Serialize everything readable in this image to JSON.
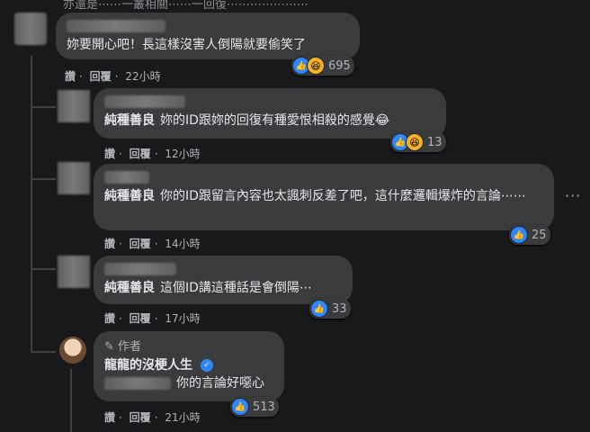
{
  "top_cut_text": "亦還是⋯⋯一叢相關⋯⋯一回復⋯⋯⋯⋯⋯⋯⋯",
  "comments": [
    {
      "text": "妳要開心吧！長這樣沒害人倒陽就要偷笑了",
      "meta": {
        "like": "讚",
        "reply": "回覆",
        "time": "22小時"
      },
      "reaction_count": "695"
    },
    {
      "tag": "純種善良",
      "text": "妳的ID跟妳的回復有種愛恨相殺的感覺😂",
      "meta": {
        "like": "讚",
        "reply": "回覆",
        "time": "12小時"
      },
      "reaction_count": "13"
    },
    {
      "tag": "純種善良",
      "text": "你的ID跟留言內容也太諷刺反差了吧，這什麼邏輯爆炸的言論⋯⋯",
      "meta": {
        "like": "讚",
        "reply": "回覆",
        "time": "14小時"
      },
      "reaction_count": "25"
    },
    {
      "tag": "純種善良",
      "text": "這個ID講這種話是會倒陽⋯",
      "meta": {
        "like": "讚",
        "reply": "回覆",
        "time": "17小時"
      },
      "reaction_count": "33"
    },
    {
      "author_badge": "作者",
      "name": "龍龍的沒梗人生",
      "text": "你的言論好噁心",
      "meta": {
        "like": "讚",
        "reply": "回覆",
        "time": "21小時"
      },
      "reaction_count": "513"
    }
  ],
  "icons": {
    "more": "more-dots-icon",
    "like": "like-icon",
    "haha": "haha-icon",
    "pencil": "pencil-icon",
    "verified": "verified-icon"
  },
  "colors": {
    "background": "#18191a",
    "bubble": "#3a3b3c",
    "like_blue": "#2d88ff",
    "meta": "#b0b3b8"
  }
}
